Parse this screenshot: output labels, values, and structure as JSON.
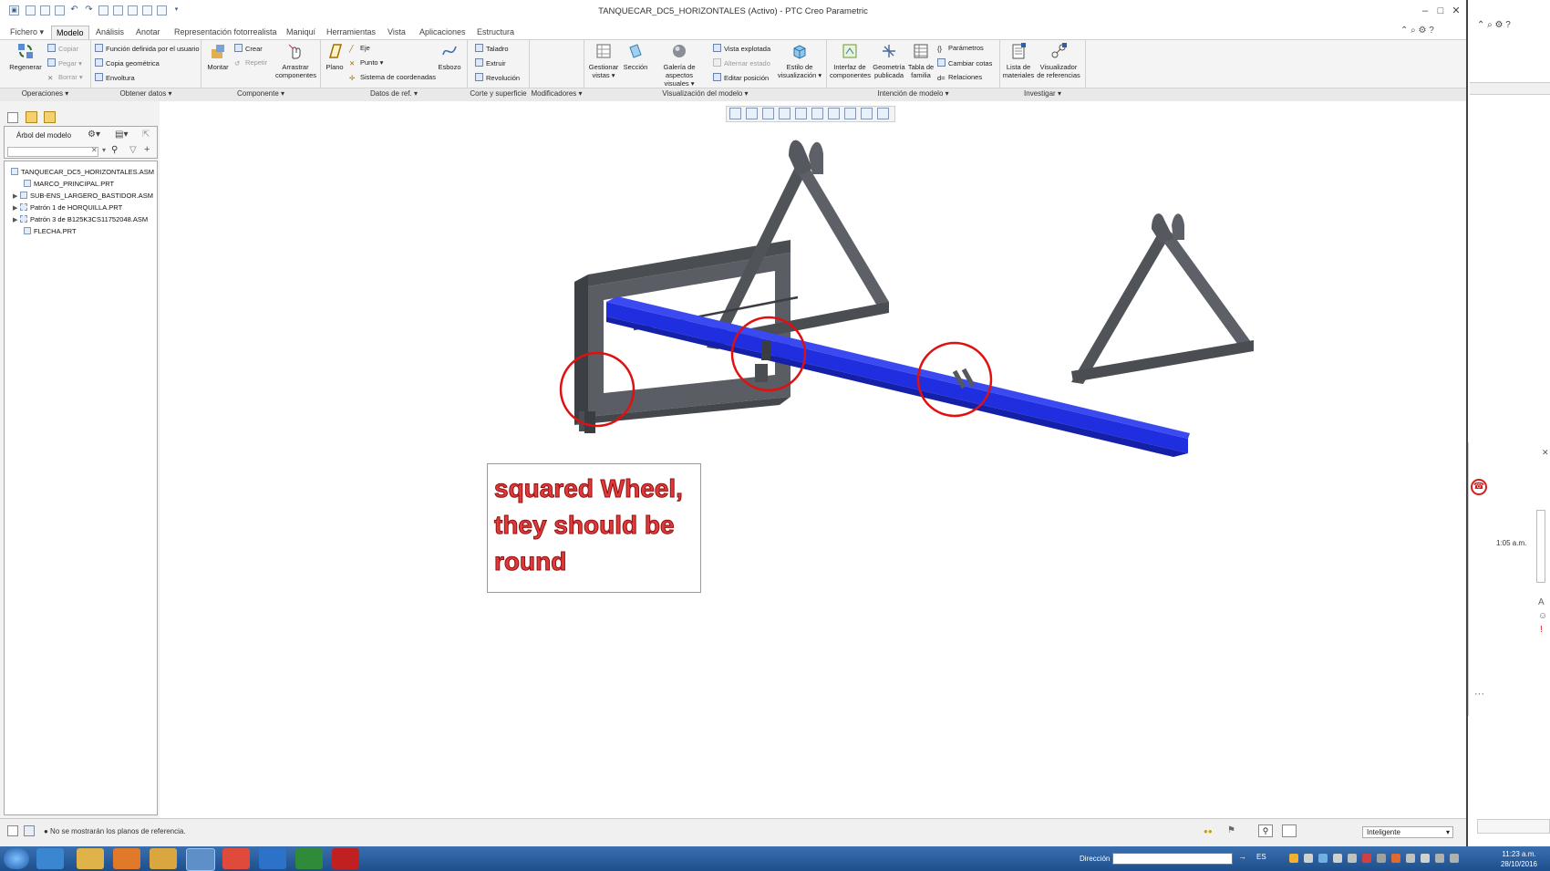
{
  "window": {
    "title": "TANQUECAR_DC5_HORIZONTALES (Activo) - PTC Creo Parametric",
    "controls": [
      "–",
      "□",
      "✕"
    ]
  },
  "tabs": [
    "Fichero ▾",
    "Modelo",
    "Análisis",
    "Anotar",
    "Representación fotorrealista",
    "Maniquí",
    "Herramientas",
    "Vista",
    "Aplicaciones",
    "Estructura"
  ],
  "ribbon": {
    "regenerar": "Regenerar",
    "ops_small": [
      "Copiar",
      "Pegar ▾",
      "Borrar ▾"
    ],
    "obtener_items": [
      "Función definida por el usuario",
      "Copia geométrica",
      "Envoltura"
    ],
    "montar": "Montar",
    "comp_small": [
      "Crear",
      "Repetir"
    ],
    "arrastrar": [
      "Arrastrar",
      "componentes"
    ],
    "plano": "Plano",
    "datos_small": [
      "Eje",
      "Punto ▾",
      "Sistema de coordenadas"
    ],
    "esbozo": "Esbozo",
    "corte_items": [
      "Taladro",
      "Extruir",
      "Revolución"
    ],
    "gestionar": [
      "Gestionar",
      "vistas ▾"
    ],
    "seccion": "Sección",
    "galeria": [
      "Galería de aspectos",
      "visuales ▾"
    ],
    "vis_small": [
      "Vista explotada",
      "Alternar estado",
      "Editar posición"
    ],
    "estilo": [
      "Estilo de",
      "visualización ▾"
    ],
    "interfaz": [
      "Interfaz de",
      "componentes"
    ],
    "geometria": [
      "Geometría",
      "publicada"
    ],
    "tabla": [
      "Tabla de",
      "familia"
    ],
    "intencion_small": [
      "Parámetros",
      "Cambiar cotas",
      "Relaciones"
    ],
    "lista": [
      "Lista de",
      "materiales"
    ],
    "visualizador": [
      "Visualizador",
      "de referencias"
    ]
  },
  "groups": [
    "Operaciones ▾",
    "Obtener datos ▾",
    "Componente ▾",
    "Datos de ref. ▾",
    "Corte y superficie ▾",
    "Modificadores ▾",
    "Visualización del modelo ▾",
    "Intención de modelo ▾",
    "Investigar ▾"
  ],
  "tree": {
    "header": "Árbol del modelo",
    "items": [
      "TANQUECAR_DC5_HORIZONTALES.ASM",
      "MARCO_PRINCIPAL.PRT",
      "SUB-ENS_LARGERO_BASTIDOR.ASM",
      "Patrón 1 de HORQUILLA.PRT",
      "Patrón 3 de B125K3CS11752048.ASM",
      "FLECHA.PRT"
    ]
  },
  "annotation": {
    "text": "squared Wheel, they should be round",
    "color": "#e03a3a"
  },
  "model": {
    "frame_color": "#5a5d63",
    "beam_color": "#1f2fe0",
    "circle_color": "#e01010"
  },
  "status": {
    "message": "● No se mostrarán los planos de referencia.",
    "filter": "Inteligente"
  },
  "side_window": {
    "time": "1:05 a.m."
  },
  "taskbar": {
    "direccion_label": "Dirección",
    "lang": "ES",
    "time": "11:23 a.m.",
    "date": "28/10/2016"
  }
}
